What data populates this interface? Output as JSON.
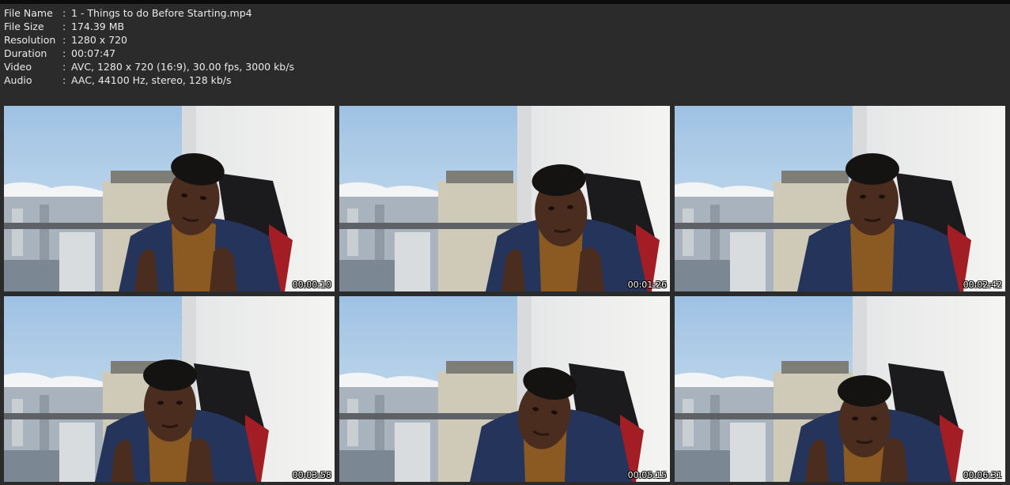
{
  "file_info": [
    {
      "label": "File Name",
      "sep": ":",
      "value": "1 - Things to do Before Starting.mp4"
    },
    {
      "label": "File Size",
      "sep": ":",
      "value": "174.39 MB"
    },
    {
      "label": "Resolution",
      "sep": ":",
      "value": "1280 x 720"
    },
    {
      "label": "Duration",
      "sep": ":",
      "value": "00:07:47"
    },
    {
      "label": "Video",
      "sep": ":",
      "value": "AVC, 1280 x 720 (16:9), 30.00 fps, 3000 kb/s"
    },
    {
      "label": "Audio",
      "sep": ":",
      "value": "AAC, 44100 Hz, stereo, 128 kb/s"
    }
  ],
  "thumbnails": [
    {
      "timestamp": "00:00:10",
      "pose": "looking-down-hands-low"
    },
    {
      "timestamp": "00:01:26",
      "pose": "talking-hands-raised"
    },
    {
      "timestamp": "00:02:42",
      "pose": "looking-camera-still"
    },
    {
      "timestamp": "00:03:58",
      "pose": "talking-hands-together"
    },
    {
      "timestamp": "00:05:15",
      "pose": "looking-down"
    },
    {
      "timestamp": "00:06:31",
      "pose": "talking-hands-together"
    }
  ],
  "colors": {
    "background": "#2b2b2b",
    "text": "#eaeaea",
    "sky": "#b9d2e6",
    "blazer": "#25345a",
    "turtleneck": "#8a5a22",
    "skin": "#4a2d1f"
  }
}
